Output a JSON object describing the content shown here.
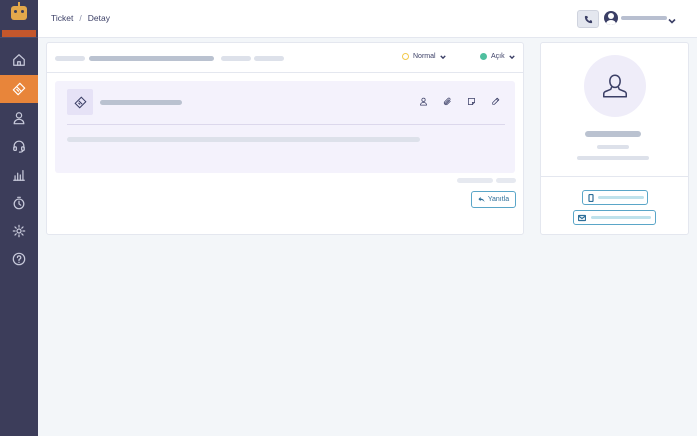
{
  "breadcrumb": {
    "root": "Ticket",
    "separator": "/",
    "current": "Detay"
  },
  "ticket": {
    "priority_label": "Normal",
    "status_label": "Açık",
    "reply_label": "Yanıtla"
  },
  "colors": {
    "sidebar_bg": "#3c3d5a",
    "active_nav": "#e8853a",
    "priority_dot": "#f2c94c",
    "status_dot": "#4fbf9f",
    "accent_border": "#5aa6c8"
  },
  "icons": [
    "home-icon",
    "ticket-icon",
    "user-icon",
    "headset-icon",
    "chart-icon",
    "timer-icon",
    "gear-icon",
    "help-icon",
    "phone-icon",
    "assign-icon",
    "attach-icon",
    "note-icon",
    "edit-icon",
    "reply-icon",
    "mobile-icon",
    "mail-icon"
  ]
}
